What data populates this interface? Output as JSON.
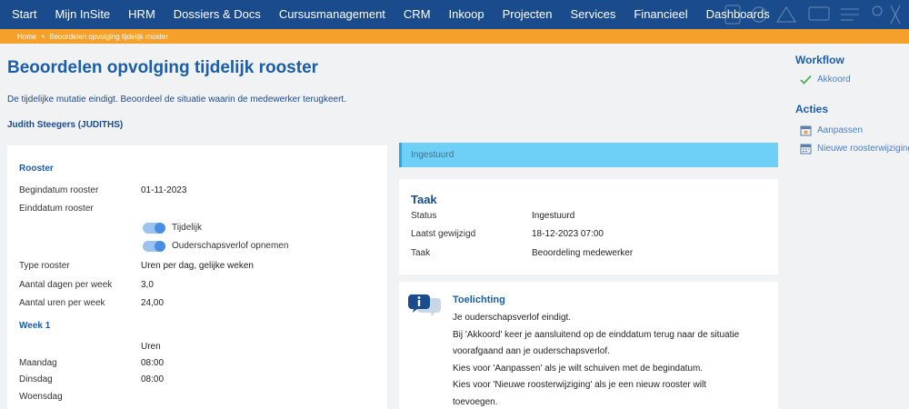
{
  "nav": {
    "items": [
      "Start",
      "Mijn InSite",
      "HRM",
      "Dossiers & Docs",
      "Cursusmanagement",
      "CRM",
      "Inkoop",
      "Projecten",
      "Services",
      "Financieel",
      "Dashboards"
    ]
  },
  "breadcrumb": {
    "home": "Home",
    "current": "Beoordelen opvolging tijdelijk rooster"
  },
  "page": {
    "title": "Beoordelen opvolging tijdelijk rooster",
    "description": "De tijdelijke mutatie eindigt. Beoordeel de situatie waarin de medewerker terugkeert.",
    "employee": "Judith Steegers (JUDITHS)"
  },
  "rooster": {
    "title": "Rooster",
    "begindatum_label": "Begindatum rooster",
    "begindatum_value": "01-11-2023",
    "einddatum_label": "Einddatum rooster",
    "toggle_tijdelijk": "Tijdelijk",
    "toggle_ouderschap": "Ouderschapsverlof opnemen",
    "type_label": "Type rooster",
    "type_value": "Uren per dag, gelijke weken",
    "dagen_label": "Aantal dagen per week",
    "dagen_value": "3,0",
    "uren_label": "Aantal uren per week",
    "uren_value": "24,00",
    "week_title": "Week 1",
    "uren_header": "Uren",
    "days": [
      {
        "day": "Maandag",
        "hours": "08:00"
      },
      {
        "day": "Dinsdag",
        "hours": "08:00"
      },
      {
        "day": "Woensdag",
        "hours": ""
      }
    ]
  },
  "status": {
    "label": "Ingestuurd"
  },
  "taak": {
    "title": "Taak",
    "rows": [
      {
        "label": "Status",
        "value": "Ingestuurd"
      },
      {
        "label": "Laatst gewijzigd",
        "value": "18-12-2023 07:00"
      },
      {
        "label": "Taak",
        "value": "Beoordeling medewerker"
      }
    ]
  },
  "toelichting": {
    "title": "Toelichting",
    "lines": [
      "Je ouderschapsverlof eindigt.",
      "Bij 'Akkoord' keer je aansluitend op de einddatum terug naar de situatie",
      "voorafgaand aan je ouderschapsverlof.",
      "Kies voor 'Aanpassen' als je wilt schuiven met de begindatum.",
      "Kies voor 'Nieuwe roosterwijziging' als je een nieuw rooster wilt",
      "toevoegen."
    ]
  },
  "sidebar": {
    "workflow_heading": "Workflow",
    "akkoord": "Akkoord",
    "acties_heading": "Acties",
    "aanpassen": "Aanpassen",
    "nieuwe": "Nieuwe roosterwijziging"
  },
  "colors": {
    "nav_bg": "#1a4b8c",
    "breadcrumb_bg": "#f5a02a",
    "accent": "#1a5ea8",
    "status_bg": "#6fd0f7",
    "check": "#4caf50"
  }
}
